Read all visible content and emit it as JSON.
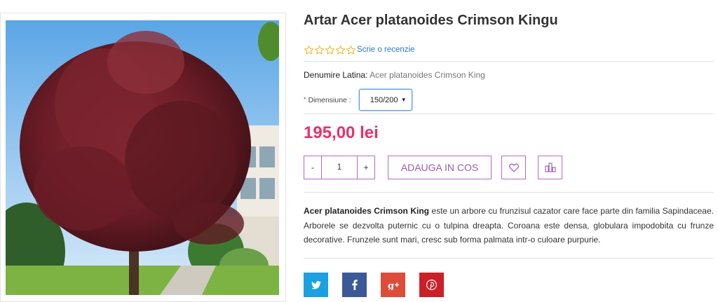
{
  "product": {
    "title": "Artar Acer platanoides Crimson Kingu",
    "rating": 0,
    "rating_max": 5,
    "review_link": "Scrie o recenzie",
    "latin_label": "Denumire Latina:",
    "latin_value": "Acer platanoides Crimson King",
    "dimension_required": "*",
    "dimension_label": "Dimensiune :",
    "dimension_selected": "150/200",
    "price": "195,00 lei"
  },
  "cart": {
    "minus": "-",
    "quantity": "1",
    "plus": "+",
    "add_label": "ADAUGA IN COS"
  },
  "description": {
    "name": "Acer platanoides Crimson King",
    "text": " este un arbore cu frunzisul cazator care face parte din familia Sapindaceae. Arborele se dezvolta puternic cu o tulpina dreapta. Coroana este densa, globulara impodobita cu frunze decorative. Frunzele sunt mari, cresc sub forma palmata intr-o culoare purpurie."
  },
  "icons": {
    "wishlist": "heart-icon",
    "compare": "compare-icon",
    "twitter": "twitter-icon",
    "facebook": "facebook-icon",
    "gplus": "google-plus-icon",
    "pinterest": "pinterest-icon"
  },
  "colors": {
    "price": "#e8316b",
    "accent": "#9b59b6",
    "link": "#2a7bc0",
    "star": "#f0b429"
  }
}
